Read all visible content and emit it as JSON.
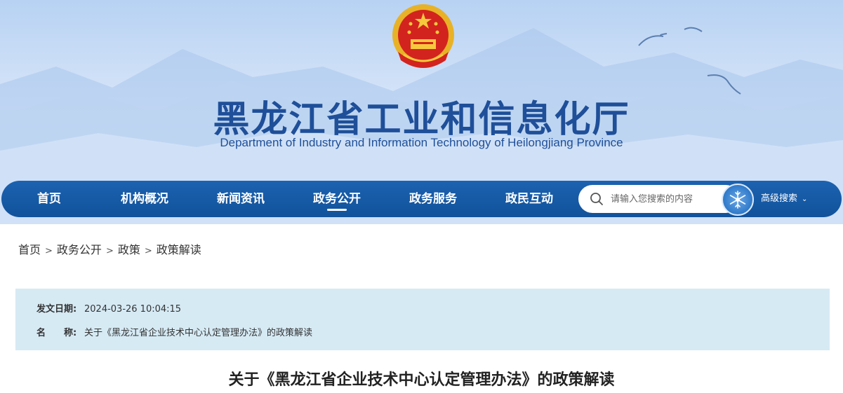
{
  "header": {
    "title": "黑龙江省工业和信息化厅",
    "subtitle": "Department of Industry and Information Technology of Heilongjiang Province"
  },
  "nav": {
    "items": [
      {
        "label": "首页"
      },
      {
        "label": "机构概况"
      },
      {
        "label": "新闻资讯"
      },
      {
        "label": "政务公开"
      },
      {
        "label": "政务服务"
      },
      {
        "label": "政民互动"
      }
    ],
    "active": "政务公开",
    "search_placeholder": "请输入您搜索的内容",
    "advanced_search": "高级搜索"
  },
  "breadcrumb": {
    "items": [
      "首页",
      "政务公开",
      "政策",
      "政策解读"
    ],
    "separator": ">"
  },
  "info": {
    "date_label": "发文日期:",
    "date_value": "2024-03-26 10:04:15",
    "name_label": "名　　称:",
    "name_value": "关于《黑龙江省企业技术中心认定管理办法》的政策解读"
  },
  "article": {
    "title": "关于《黑龙江省企业技术中心认定管理办法》的政策解读"
  },
  "colors": {
    "nav_bg": "#11529b",
    "title_blue": "#1f4f99",
    "info_bg": "#d6eaf4"
  },
  "icons": {
    "emblem": "national-emblem",
    "search": "search-icon",
    "search_button": "snowflake-icon",
    "dropdown": "chevron-down-icon"
  }
}
